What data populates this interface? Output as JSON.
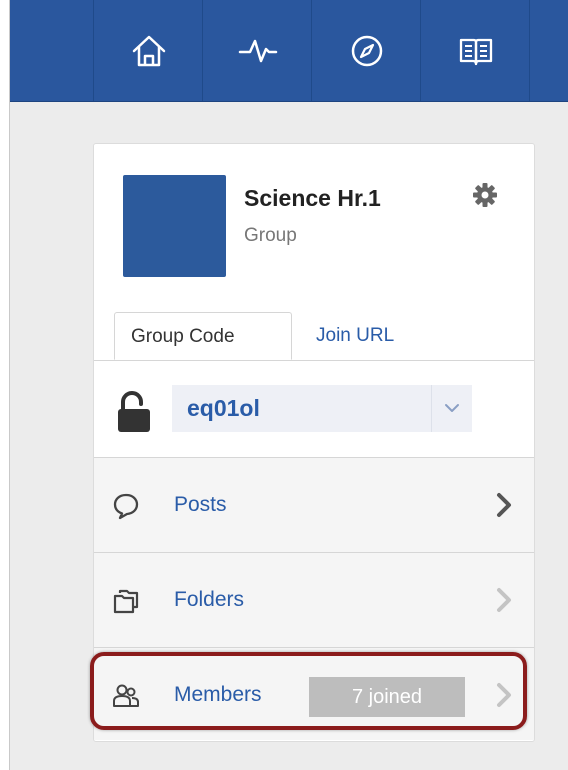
{
  "nav": {
    "items": [
      {
        "icon": "home-icon"
      },
      {
        "icon": "activity-icon"
      },
      {
        "icon": "compass-icon"
      },
      {
        "icon": "book-icon"
      }
    ]
  },
  "group": {
    "name": "Science Hr.1",
    "type": "Group"
  },
  "tabs": [
    {
      "label": "Group Code",
      "active": true
    },
    {
      "label": "Join URL",
      "active": false
    }
  ],
  "code": {
    "value": "eq01ol"
  },
  "menu": {
    "posts_label": "Posts",
    "folders_label": "Folders",
    "members_label": "Members",
    "members_badge": "7 joined"
  },
  "colors": {
    "brand_blue": "#2a579e",
    "link_blue": "#2a5ca8",
    "highlight_red": "#8b1c1c"
  }
}
